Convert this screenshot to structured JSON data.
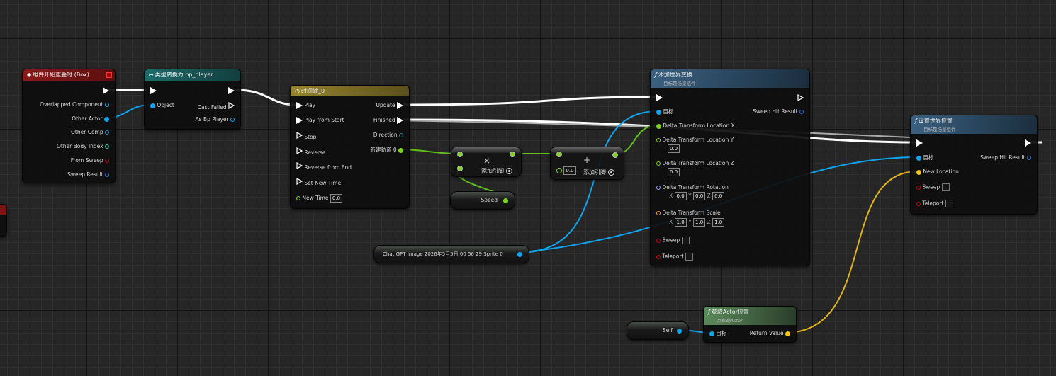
{
  "colors": {
    "exec": "#ffffff",
    "object": "#0ea5f0",
    "float": "#7ed321",
    "vector": "#f5c518",
    "rotator": "#9b9bff",
    "transform": "#f0a030",
    "bool": "#b80000",
    "struct": "#1e6fd9",
    "int": "#2fd3b0",
    "event_header": "#7c1414",
    "cast_header": "#1c5a5a",
    "timeline_header": "#8a7a2a",
    "function_header": "#33536e",
    "pure_function_header": "#4a6f4a"
  },
  "event_node": {
    "icon": "event-diamond-icon",
    "title": "组件开始重叠时 (Box)",
    "outputs": [
      "Overlapped Component",
      "Other Actor",
      "Other Comp",
      "Other Body Index",
      "From Sweep",
      "Sweep Result"
    ]
  },
  "cast_node": {
    "icon": "cast-arrow-icon",
    "title": "类型转换为 bp_player",
    "input_object": "Object",
    "output_cast_failed": "Cast Failed",
    "output_as": "As Bp Player"
  },
  "timeline_node": {
    "icon": "clock-icon",
    "title": "时间轴_0",
    "inputs": [
      "Play",
      "Play from Start",
      "Stop",
      "Reverse",
      "Reverse from End",
      "Set New Time",
      "New Time"
    ],
    "new_time_value": "0.0",
    "outputs": [
      "Update",
      "Finished",
      "Direction",
      "新建轨道 0"
    ]
  },
  "multiply_node": {
    "symbol": "×",
    "add_pin_label": "添加引脚"
  },
  "add_node": {
    "symbol": "+",
    "input_value": "0.0",
    "add_pin_label": "添加引脚"
  },
  "speed_var": {
    "label": "Speed"
  },
  "sprite_var": {
    "label": "Chat GPT Image 2026年5月5日 00 56 29 Sprite 0"
  },
  "add_world_transform": {
    "icon": "function-icon",
    "title": "添加世界变换",
    "subtitle": "目标是场景组件",
    "target_label": "目标",
    "sweep_hit_result": "Sweep Hit Result",
    "delta_loc_x": "Delta Transform Location X",
    "delta_loc_y": "Delta Transform Location Y",
    "delta_loc_y_val": "0.0",
    "delta_loc_z": "Delta Transform Location Z",
    "delta_loc_z_val": "0.0",
    "delta_rot": "Delta Transform Rotation",
    "rot_x_label": "X",
    "rot_x": "0.0",
    "rot_y_label": "Y",
    "rot_y": "0.0",
    "rot_z_label": "Z",
    "rot_z": "0.0",
    "delta_scale": "Delta Transform Scale",
    "scale_x_label": "X",
    "scale_x": "1.0",
    "scale_y_label": "Y",
    "scale_y": "1.0",
    "scale_z_label": "Z",
    "scale_z": "1.0",
    "sweep": "Sweep",
    "teleport": "Teleport"
  },
  "set_world_location": {
    "icon": "function-icon",
    "title": "设置世界位置",
    "subtitle": "目标是场景组件",
    "target_label": "目标",
    "sweep_hit_result": "Sweep Hit Result",
    "new_location": "New Location",
    "sweep": "Sweep",
    "teleport": "Teleport"
  },
  "self_node": {
    "label": "Self"
  },
  "get_actor_location": {
    "icon": "function-icon",
    "title": "获取Actor位置",
    "subtitle": "目标是Actor",
    "target_label": "目标",
    "return_value": "Return Value"
  }
}
